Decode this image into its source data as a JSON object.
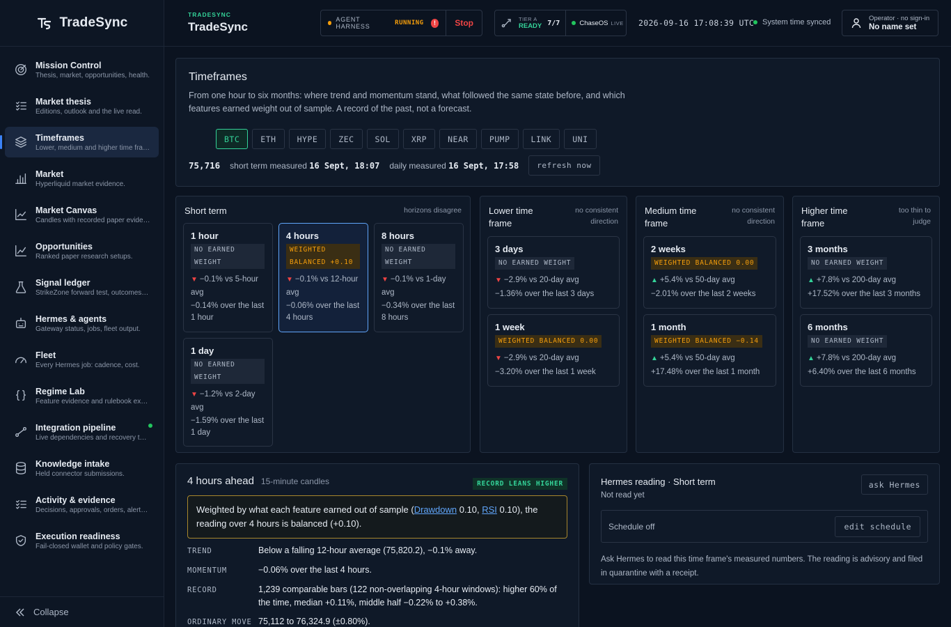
{
  "brand": {
    "name": "TradeSync",
    "kicker": "TRADESYNC",
    "title": "TradeSync"
  },
  "sidebar": {
    "items": [
      {
        "title": "Mission Control",
        "sub": "Thesis, market, opportunities, health.",
        "icon": "target-icon"
      },
      {
        "title": "Market thesis",
        "sub": "Editions, outlook and the live read.",
        "icon": "list-icon"
      },
      {
        "title": "Timeframes",
        "sub": "Lower, medium and higher time frames",
        "icon": "layers-icon",
        "active": true
      },
      {
        "title": "Market",
        "sub": "Hyperliquid market evidence.",
        "icon": "bar-chart-icon"
      },
      {
        "title": "Market Canvas",
        "sub": "Candles with recorded paper evidence",
        "icon": "line-chart-icon"
      },
      {
        "title": "Opportunities",
        "sub": "Ranked paper research setups.",
        "icon": "trend-icon"
      },
      {
        "title": "Signal ledger",
        "sub": "StrikeZone forward test, outcomes, and more",
        "icon": "flask-icon"
      },
      {
        "title": "Hermes & agents",
        "sub": "Gateway status, jobs, fleet output.",
        "icon": "robot-icon"
      },
      {
        "title": "Fleet",
        "sub": "Every Hermes job: cadence, cost.",
        "icon": "gauge-icon"
      },
      {
        "title": "Regime Lab",
        "sub": "Feature evidence and rulebook experiments",
        "icon": "braces-icon"
      },
      {
        "title": "Integration pipeline",
        "sub": "Live dependencies and recovery targets",
        "icon": "pipeline-icon",
        "dot": true
      },
      {
        "title": "Knowledge intake",
        "sub": "Held connector submissions.",
        "icon": "database-icon"
      },
      {
        "title": "Activity & evidence",
        "sub": "Decisions, approvals, orders, alerts, and more",
        "icon": "checklist-icon"
      },
      {
        "title": "Execution readiness",
        "sub": "Fail-closed wallet and policy gates.",
        "icon": "shield-icon"
      }
    ],
    "collapse": "Collapse"
  },
  "topbar": {
    "harness_label": "AGENT HARNESS",
    "harness_status": "RUNNING",
    "alert": "!",
    "stop": "Stop",
    "tier_label": "TIER A",
    "tier_ready": "READY",
    "tier_count": "7/7",
    "os_name": "ChaseOS",
    "os_live": "LIVE",
    "clock": "2026-09-16 17:08:39 UTC",
    "sync": "System time synced",
    "operator_meta": "Operator · no sign-in",
    "operator_name": "No name set"
  },
  "timeframes": {
    "title": "Timeframes",
    "desc": "From one hour to six months: where trend and momentum stand, what followed the same state before, and which features earned weight out of sample. A record of the past, not a forecast.",
    "assets": [
      "BTC",
      "ETH",
      "HYPE",
      "ZEC",
      "SOL",
      "XRP",
      "NEAR",
      "PUMP",
      "LINK",
      "UNI"
    ],
    "active_asset": "BTC",
    "price": "75,716",
    "short_label": "short term measured",
    "short_time": "16 Sept, 18:07",
    "daily_label": "daily measured",
    "daily_time": "16 Sept, 17:58",
    "refresh": "refresh now"
  },
  "groups": {
    "short": {
      "title": "Short term",
      "note": "horizons disagree",
      "cards": [
        {
          "title": "1 hour",
          "badge": "NO EARNED WEIGHT",
          "dir": "down",
          "change": "−0.1% vs 5-hour avg",
          "over": "−0.14% over the last 1 hour"
        },
        {
          "title": "4 hours",
          "badge": "WEIGHTED BALANCED +0.10",
          "warn": true,
          "dir": "down",
          "change": "−0.1% vs 12-hour avg",
          "over": "−0.06% over the last 4 hours",
          "active": true
        },
        {
          "title": "8 hours",
          "badge": "NO EARNED WEIGHT",
          "dir": "down",
          "change": "−0.1% vs 1-day avg",
          "over": "−0.34% over the last 8 hours"
        },
        {
          "title": "1 day",
          "badge": "NO EARNED WEIGHT",
          "dir": "down",
          "change": "−1.2% vs 2-day avg",
          "over": "−1.59% over the last 1 day"
        }
      ]
    },
    "lower": {
      "title": "Lower time frame",
      "note": "no consistent direction",
      "cards": [
        {
          "title": "3 days",
          "badge": "NO EARNED WEIGHT",
          "dir": "down",
          "change": "−2.9% vs 20-day avg",
          "over": "−1.36% over the last 3 days"
        },
        {
          "title": "1 week",
          "badge": "WEIGHTED BALANCED 0.00",
          "warn": true,
          "dir": "down",
          "change": "−2.9% vs 20-day avg",
          "over": "−3.20% over the last 1 week"
        }
      ]
    },
    "medium": {
      "title": "Medium time frame",
      "note": "no consistent direction",
      "cards": [
        {
          "title": "2 weeks",
          "badge": "WEIGHTED BALANCED 0.00",
          "warn": true,
          "dir": "up",
          "change": "+5.4% vs 50-day avg",
          "over": "−2.01% over the last 2 weeks"
        },
        {
          "title": "1 month",
          "badge": "WEIGHTED BALANCED −0.14",
          "warn": true,
          "dir": "up",
          "change": "+5.4% vs 50-day avg",
          "over": "+17.48% over the last 1 month"
        }
      ]
    },
    "higher": {
      "title": "Higher time frame",
      "note": "too thin to judge",
      "cards": [
        {
          "title": "3 months",
          "badge": "NO EARNED WEIGHT",
          "dir": "up",
          "change": "+7.8% vs 200-day avg",
          "over": "+17.52% over the last 3 months"
        },
        {
          "title": "6 months",
          "badge": "NO EARNED WEIGHT",
          "dir": "up",
          "change": "+7.8% vs 200-day avg",
          "over": "+6.40% over the last 6 months"
        }
      ]
    }
  },
  "ahead": {
    "title": "4 hours ahead",
    "sub": "15-minute candles",
    "badge": "RECORD LEANS HIGHER",
    "weighted_pre": "Weighted by what each feature earned out of sample (",
    "link1": "Drawdown",
    "mid1": " 0.10, ",
    "link2": "RSI",
    "weighted_post": " 0.10), the reading over 4 hours is balanced (+0.10).",
    "rows": [
      {
        "k": "TREND",
        "v": "Below a falling 12-hour average (75,820.2), −0.1% away."
      },
      {
        "k": "MOMENTUM",
        "v": "−0.06% over the last 4 hours."
      },
      {
        "k": "RECORD",
        "v": "1,239 comparable bars (122 non-overlapping 4-hour windows): higher 60% of the time, median +0.11%, middle half −0.22% to +0.38%."
      },
      {
        "k": "ORDINARY MOVE",
        "v": "75,112 to 76,324.9 (±0.80%)."
      }
    ]
  },
  "hermes": {
    "title": "Hermes reading · Short term",
    "sub": "Not read yet",
    "ask": "ask Hermes",
    "schedule": "Schedule off",
    "edit": "edit schedule",
    "note": "Ask Hermes to read this time frame's measured numbers. The reading is advisory and filed in quarantine with a receipt."
  },
  "colors": {
    "accent": "#34d399",
    "warn": "#f59e0b",
    "down": "#ef4444",
    "link": "#60a5fa"
  }
}
